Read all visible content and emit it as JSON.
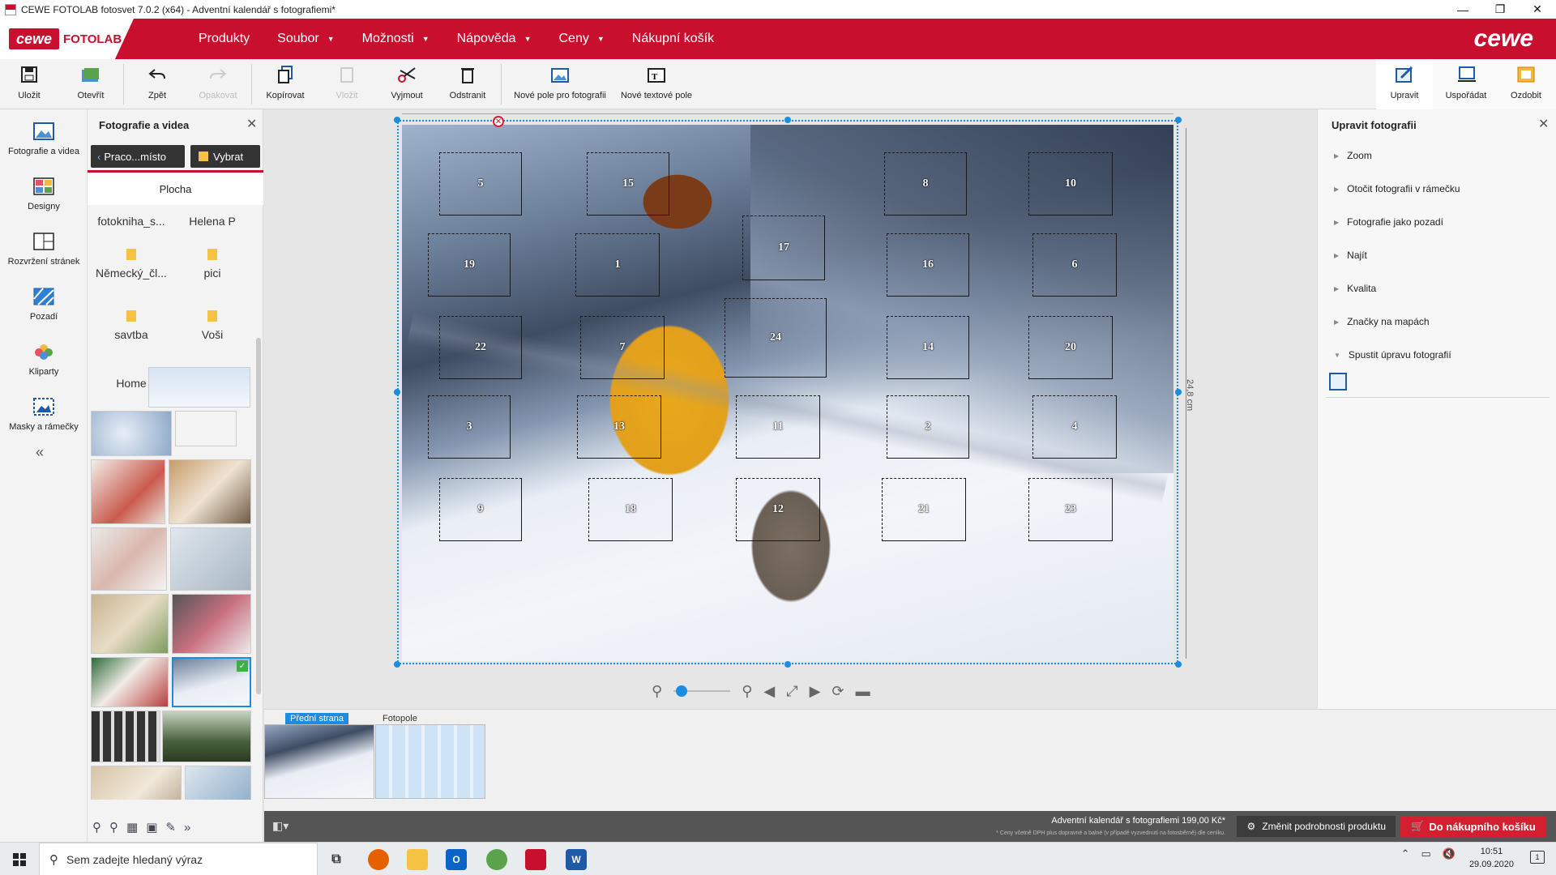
{
  "window": {
    "title": "CEWE FOTOLAB fotosvet 7.0.2 (x64) - Adventní kalendář s fotografiemi*",
    "minimize": "—",
    "maximize": "❐",
    "close": "✕"
  },
  "brand": {
    "logo_cewe": "cewe",
    "logo_fotolab": "FOTOLAB",
    "brand_right": "cewe",
    "color_red": "#c8102e"
  },
  "menu": [
    {
      "label": "Produkty",
      "caret": false
    },
    {
      "label": "Soubor",
      "caret": true
    },
    {
      "label": "Možnosti",
      "caret": true
    },
    {
      "label": "Nápověda",
      "caret": true
    },
    {
      "label": "Ceny",
      "caret": true
    },
    {
      "label": "Nákupní košík",
      "caret": false
    }
  ],
  "toolbar": {
    "save": "Uložit",
    "open": "Otevřít",
    "undo": "Zpět",
    "redo": "Opakovat",
    "copy": "Kopírovat",
    "paste": "Vložit",
    "cut": "Vyjmout",
    "delete": "Odstranit",
    "new_photo_field": "Nové pole pro fotografii",
    "new_text_field": "Nové textové pole",
    "edit": "Upravit",
    "arrange": "Uspořádat",
    "decorate": "Ozdobit"
  },
  "rail": [
    {
      "label": "Fotografie a videa",
      "icon": "photo-icon"
    },
    {
      "label": "Designy",
      "icon": "designs-icon"
    },
    {
      "label": "Rozvržení stránek",
      "icon": "layout-icon"
    },
    {
      "label": "Pozadí",
      "icon": "background-icon"
    },
    {
      "label": "Kliparty",
      "icon": "clipart-icon"
    },
    {
      "label": "Masky a rámečky",
      "icon": "masks-icon"
    }
  ],
  "rail_collapse": "«",
  "photos_panel": {
    "title": "Fotografie a videa",
    "close": "✕",
    "back_button": "Praco...místo",
    "select_button": "Vybrat",
    "location": "Plocha",
    "folders": [
      "fotokniha_s...",
      "Helena P",
      "Německý_čl...",
      "pici",
      "savtba",
      "Voši",
      "Home"
    ]
  },
  "canvas": {
    "height_label": "24,8 cm",
    "doors": [
      "5",
      "15",
      "8",
      "10",
      "19",
      "1",
      "17",
      "16",
      "6",
      "22",
      "7",
      "24",
      "14",
      "20",
      "3",
      "13",
      "11",
      "2",
      "4",
      "9",
      "18",
      "12",
      "21",
      "23"
    ]
  },
  "zoom_level": 0.05,
  "pages": {
    "front": "Přední strana",
    "photofield": "Fotopole"
  },
  "right_panel": {
    "title": "Upravit fotografii",
    "close": "✕",
    "items": [
      "Zoom",
      "Otočit fotografii v rámečku",
      "Fotografie jako pozadí",
      "Najít",
      "Kvalita",
      "Značky na mapách",
      "Spustit úpravu fotografií"
    ]
  },
  "status": {
    "price": "Adventní kalendář s fotografiemi 199,00 Kč*",
    "note": "* Ceny včetně DPH plus dopravné a balné (v případě vyzvednutí na fotosběrně) dle ceníku.",
    "details_button": "Změnit podrobnosti produktu",
    "cart_button": "Do nákupního košíku"
  },
  "taskbar": {
    "search_placeholder": "Sem zadejte hledaný výraz",
    "time": "10:51",
    "date": "29.09.2020"
  }
}
